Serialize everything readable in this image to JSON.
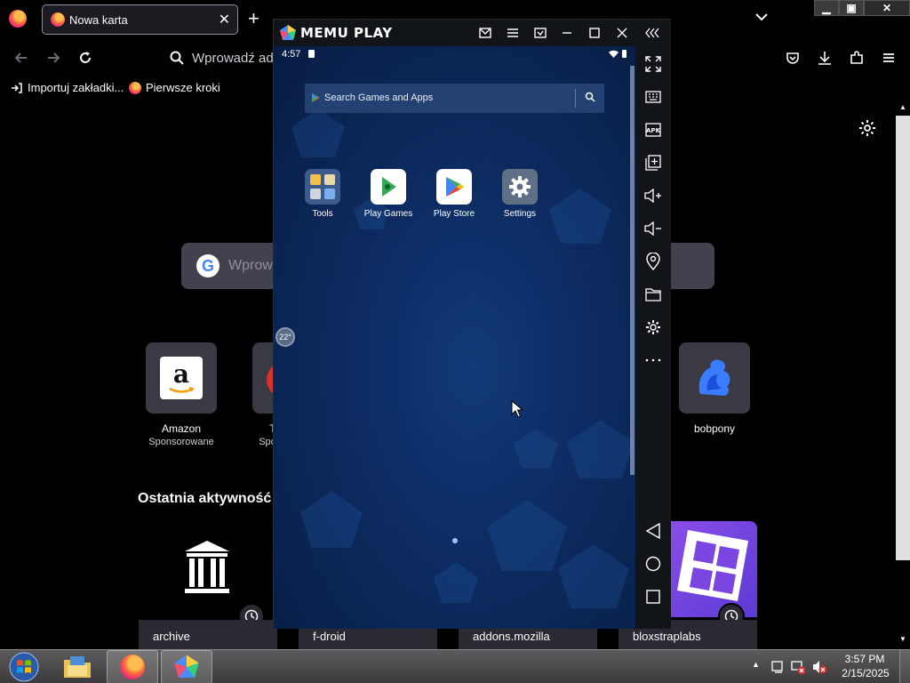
{
  "firefox": {
    "tab_title": "Nowa karta",
    "tab_close": "✕",
    "new_tab": "+",
    "url_placeholder": "Wprowadź adr",
    "bookmarks": [
      {
        "label": "Importuj zakładki..."
      },
      {
        "label": "Pierwsze kroki"
      }
    ],
    "google_search_text": "Wprow",
    "shortcuts": [
      {
        "label": "Amazon",
        "sublabel": "Sponsorowane"
      },
      {
        "label": "T",
        "sublabel": "Spo"
      },
      {
        "label": "bobpony",
        "sublabel": ""
      }
    ],
    "recent_heading": "Ostatnia aktywność",
    "recent_cards": [
      {
        "label": "archive"
      },
      {
        "label": "f-droid"
      },
      {
        "label": "addons.mozilla"
      },
      {
        "label": "bloxstraplabs"
      }
    ],
    "window_controls": {
      "minimize": "▁",
      "maximize": "▣",
      "close": "✕"
    }
  },
  "memu": {
    "title": "MEMU PLAY",
    "status_time": "4:57",
    "search_hint": "Search Games and Apps",
    "apps": [
      {
        "label": "Tools"
      },
      {
        "label": "Play Games"
      },
      {
        "label": "Play Store"
      },
      {
        "label": "Settings"
      }
    ],
    "floating_ball_text": "22°"
  },
  "taskbar": {
    "time": "3:57 PM",
    "date": "2/15/2025"
  },
  "colors": {
    "firefox_bg": "#000000",
    "tile_bg": "#3a3944",
    "memu_chrome": "#111419",
    "android_bg": "#0d2c63"
  }
}
